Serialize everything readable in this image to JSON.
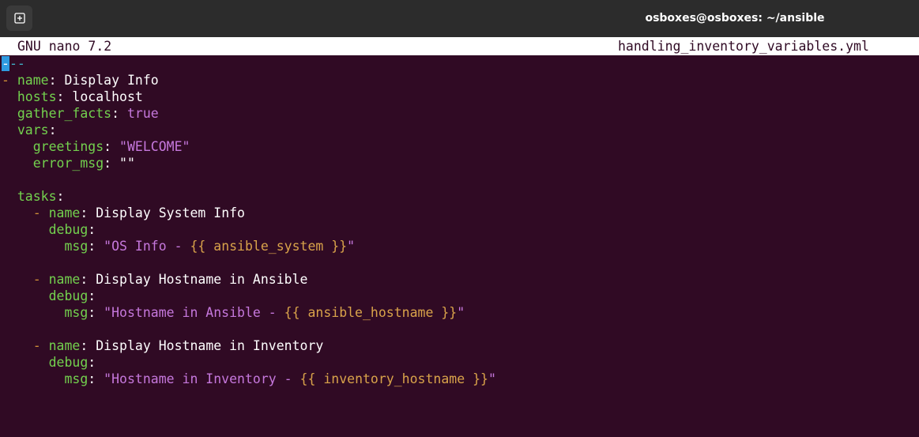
{
  "window": {
    "title": "osboxes@osboxes: ~/ansible",
    "new_tab_icon": "new-tab-icon"
  },
  "nano": {
    "version": "GNU nano 7.2",
    "filename": "handling_inventory_variables.yml"
  },
  "lines": {
    "l1_doc_sep_cursor": "-",
    "l1_doc_sep_rest": "--",
    "l2_dash": "-",
    "l2_key": "name",
    "l2_val": "Display Info",
    "l3_key": "hosts",
    "l3_val": "localhost",
    "l4_key": "gather_facts",
    "l4_val": "true",
    "l5_key": "vars",
    "l6_key": "greetings",
    "l6_val": "\"WELCOME\"",
    "l7_key": "error_msg",
    "l7_val": "\"\"",
    "l9_key": "tasks",
    "t1_dash": "-",
    "t1_key": "name",
    "t1_val": "Display System Info",
    "t1_debug": "debug",
    "t1_msg_key": "msg",
    "t1_msg_str_a": "\"OS Info - ",
    "t1_msg_jinja": "{{ ansible_system }}",
    "t1_msg_str_b": "\"",
    "t2_dash": "-",
    "t2_key": "name",
    "t2_val": "Display Hostname in Ansible",
    "t2_debug": "debug",
    "t2_msg_key": "msg",
    "t2_msg_str_a": "\"Hostname in Ansible - ",
    "t2_msg_jinja": "{{ ansible_hostname }}",
    "t2_msg_str_b": "\"",
    "t3_dash": "-",
    "t3_key": "name",
    "t3_val": "Display Hostname in Inventory",
    "t3_debug": "debug",
    "t3_msg_key": "msg",
    "t3_msg_str_a": "\"Hostname in Inventory - ",
    "t3_msg_jinja": "{{ inventory_hostname }}",
    "t3_msg_str_b": "\""
  },
  "colors": {
    "terminal_bg": "#300a24",
    "titlebar_bg": "#2c2c2c",
    "key": "#73d14e",
    "dash": "#ce8f38",
    "string": "#c678dd",
    "jinja": "#d9a34a",
    "doc_separator": "#3fb1c6",
    "cursor": "#2f9be0"
  }
}
